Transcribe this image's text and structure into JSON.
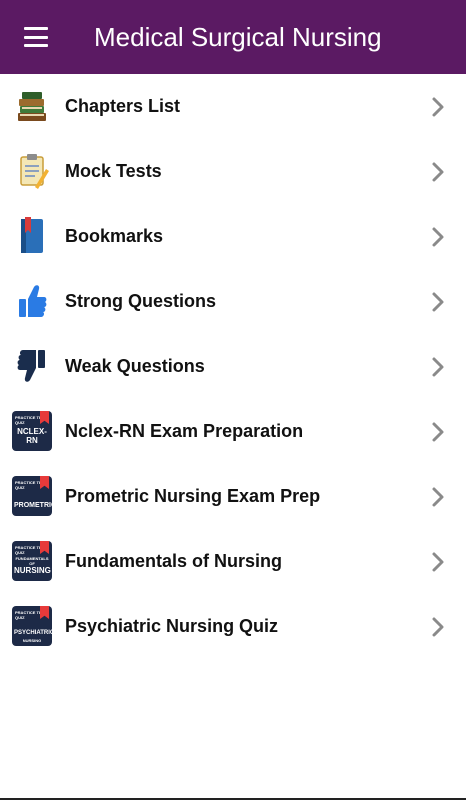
{
  "app": {
    "title": "Medical Surgical Nursing"
  },
  "menu": [
    {
      "label": "Chapters List",
      "icon": "books-icon"
    },
    {
      "label": "Mock Tests",
      "icon": "clipboard-pencil-icon"
    },
    {
      "label": "Bookmarks",
      "icon": "bookmark-book-icon"
    },
    {
      "label": "Strong Questions",
      "icon": "thumbs-up-icon"
    },
    {
      "label": "Weak Questions",
      "icon": "thumbs-down-icon"
    },
    {
      "label": "Nclex-RN Exam Preparation",
      "icon": "nclex-rn-quiz-icon",
      "badge": "NCLEX-RN"
    },
    {
      "label": "Prometric Nursing Exam Prep",
      "icon": "prometric-quiz-icon",
      "badge": "PROMETRIC"
    },
    {
      "label": "Fundamentals of Nursing",
      "icon": "fundamentals-quiz-icon",
      "badge": "NURSING",
      "badge_top": "FUNDAMENTALS OF"
    },
    {
      "label": "Psychiatric Nursing Quiz",
      "icon": "psychiatric-quiz-icon",
      "badge": "PSYCHIATRIC",
      "badge_top": "NURSING"
    }
  ],
  "badge_header": "PRACTICE TEST QUIZ",
  "colors": {
    "appbar": "#5b1a63",
    "chevron": "#8a8a8a",
    "label": "#111111"
  }
}
